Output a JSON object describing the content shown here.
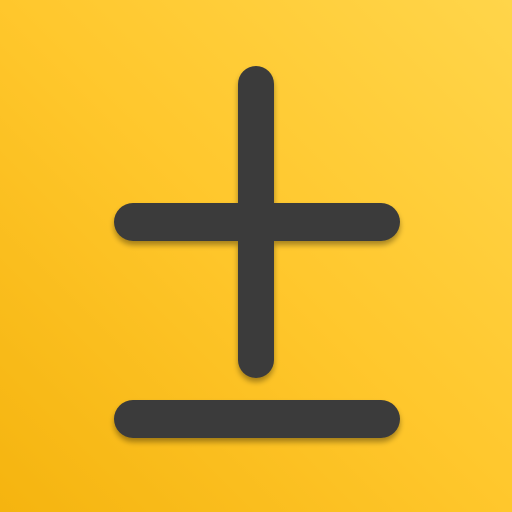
{
  "icon": {
    "symbol_name": "plus-minus-icon",
    "colors": {
      "background_light": "#FFD54A",
      "background_mid": "#FFC72C",
      "background_dark": "#F5B40F",
      "glyph": "#3A3A3A",
      "shadow": "#000000"
    }
  }
}
